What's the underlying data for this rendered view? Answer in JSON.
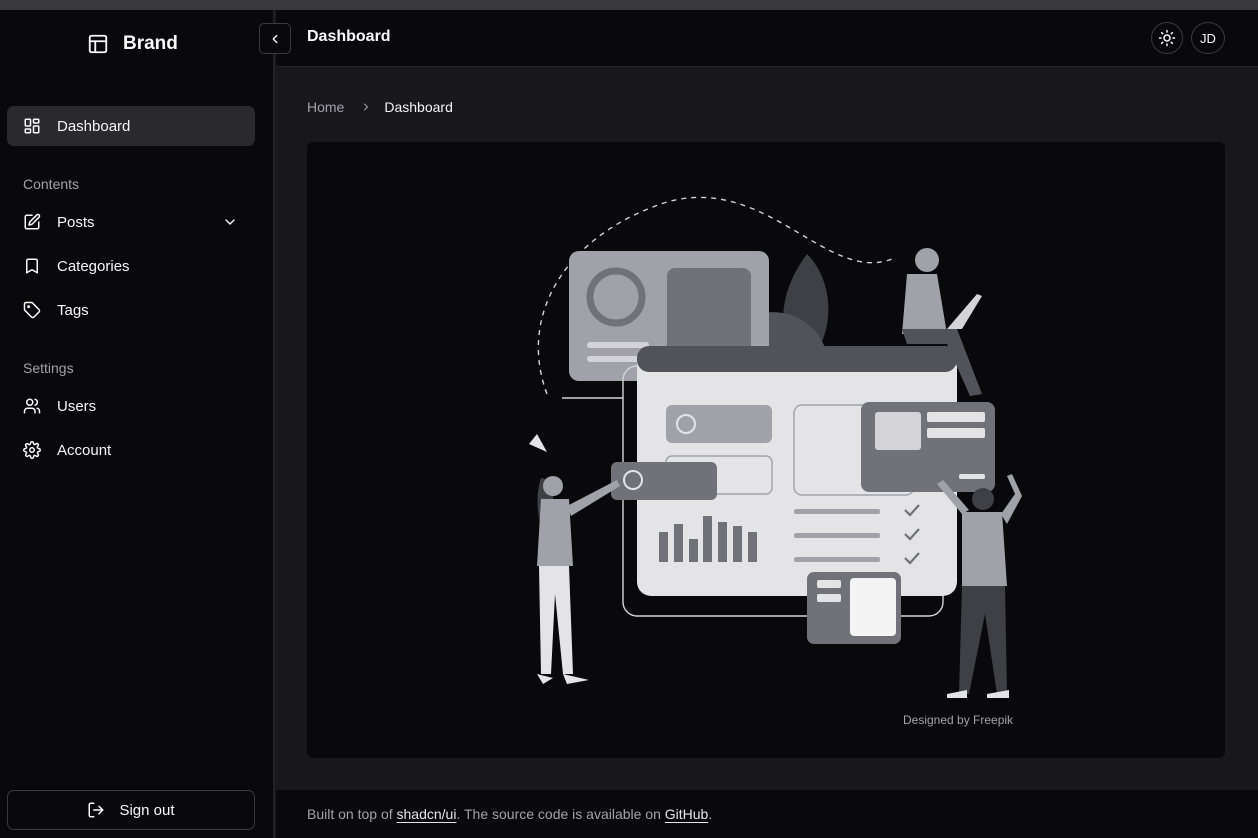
{
  "brand": {
    "name": "Brand",
    "icon": "layout-panel-icon"
  },
  "sidebar": {
    "primary": [
      {
        "label": "Dashboard",
        "icon": "layout-grid-icon",
        "active": true
      }
    ],
    "sections": [
      {
        "label": "Contents",
        "items": [
          {
            "label": "Posts",
            "icon": "pen-square-icon",
            "expandable": true
          },
          {
            "label": "Categories",
            "icon": "bookmark-icon"
          },
          {
            "label": "Tags",
            "icon": "tag-icon"
          }
        ]
      },
      {
        "label": "Settings",
        "items": [
          {
            "label": "Users",
            "icon": "users-icon"
          },
          {
            "label": "Account",
            "icon": "settings-gear-icon"
          }
        ]
      }
    ],
    "signout_label": "Sign out"
  },
  "header": {
    "title": "Dashboard",
    "avatar_initials": "JD",
    "theme_icon": "sun-icon"
  },
  "breadcrumb": {
    "home": "Home",
    "current": "Dashboard"
  },
  "card": {
    "credit": "Designed by Freepik"
  },
  "footer": {
    "prefix": "Built on top of ",
    "link1": "shadcn/ui",
    "middle": ". The source code is available on ",
    "link2": "GitHub",
    "suffix": "."
  }
}
